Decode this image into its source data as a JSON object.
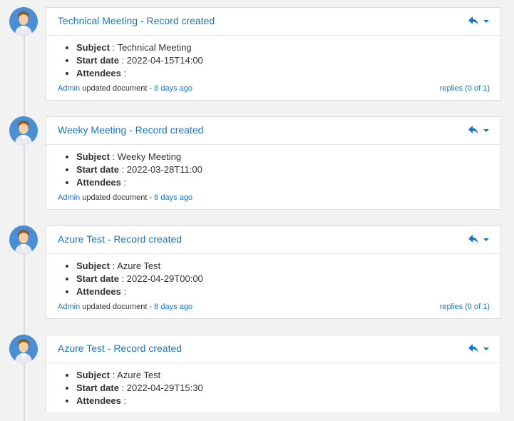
{
  "entries": [
    {
      "title": "Technical Meeting - Record created",
      "fields": [
        {
          "key": "Subject",
          "value": " : Technical Meeting"
        },
        {
          "key": "Start date",
          "value": " : 2022-04-15T14:00"
        },
        {
          "key": "Attendees",
          "value": " :"
        }
      ],
      "author": "Admin",
      "action": " updated document - ",
      "time": "8 days ago",
      "replies": "replies (0 of 1)"
    },
    {
      "title": "Weeky Meeting - Record created",
      "fields": [
        {
          "key": "Subject",
          "value": " : Weeky Meeting"
        },
        {
          "key": "Start date",
          "value": " : 2022-03-28T11:00"
        },
        {
          "key": "Attendees",
          "value": " :"
        }
      ],
      "author": "Admin",
      "action": " updated document - ",
      "time": "8 days ago",
      "replies": ""
    },
    {
      "title": "Azure Test - Record created",
      "fields": [
        {
          "key": "Subject",
          "value": " : Azure Test"
        },
        {
          "key": "Start date",
          "value": " : 2022-04-29T00:00"
        },
        {
          "key": "Attendees",
          "value": " :"
        }
      ],
      "author": "Admin",
      "action": " updated document - ",
      "time": "8 days ago",
      "replies": "replies (0 of 1)"
    },
    {
      "title": "Azure Test - Record created",
      "fields": [
        {
          "key": "Subject",
          "value": " : Azure Test"
        },
        {
          "key": "Start date",
          "value": " : 2022-04-29T15:30"
        },
        {
          "key": "Attendees",
          "value": " :"
        }
      ],
      "author": "",
      "action": "",
      "time": "",
      "replies": ""
    }
  ],
  "icons": {
    "reply": "reply-icon",
    "dropdown": "chevron-down-icon",
    "avatar": "user-avatar"
  },
  "colors": {
    "accent": "#1976c5",
    "avatar_bg": "#4a8fd3"
  }
}
